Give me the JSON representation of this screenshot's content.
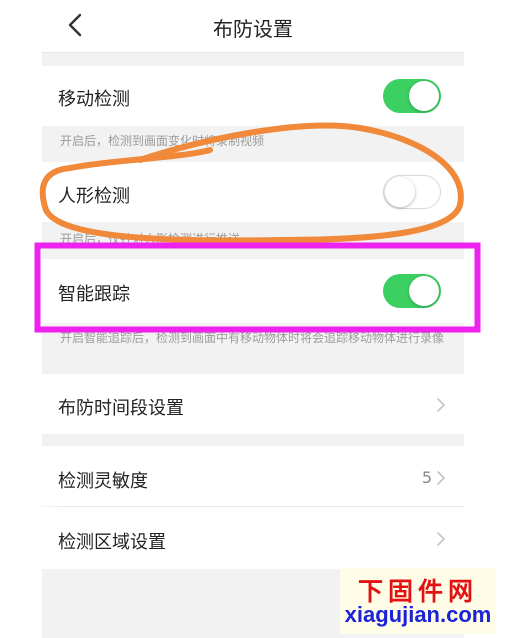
{
  "header": {
    "title": "布防设置"
  },
  "settings": {
    "motion_detection": {
      "label": "移动检测",
      "enabled": true,
      "hint": "开启后，检测到画面变化时将录制视频"
    },
    "human_detection": {
      "label": "人形检测",
      "enabled": false,
      "hint": "开启后，仅针对人形检测进行推送"
    },
    "smart_tracking": {
      "label": "智能跟踪",
      "enabled": true,
      "hint": "开启智能追踪后，检测到画面中有移动物体时将会追踪移动物体进行录像"
    },
    "schedule": {
      "label": "布防时间段设置"
    },
    "sensitivity": {
      "label": "检测灵敏度",
      "value": "5"
    },
    "area": {
      "label": "检测区域设置"
    }
  },
  "watermark": {
    "cn": "下固件网",
    "en": "xiagujian.com"
  },
  "colors": {
    "toggle_on": "#3ccf62",
    "circle_annotation": "#f0893a",
    "box_annotation": "#ee22ee",
    "watermark_cn": "#e21212",
    "watermark_en": "#1b23d6"
  }
}
